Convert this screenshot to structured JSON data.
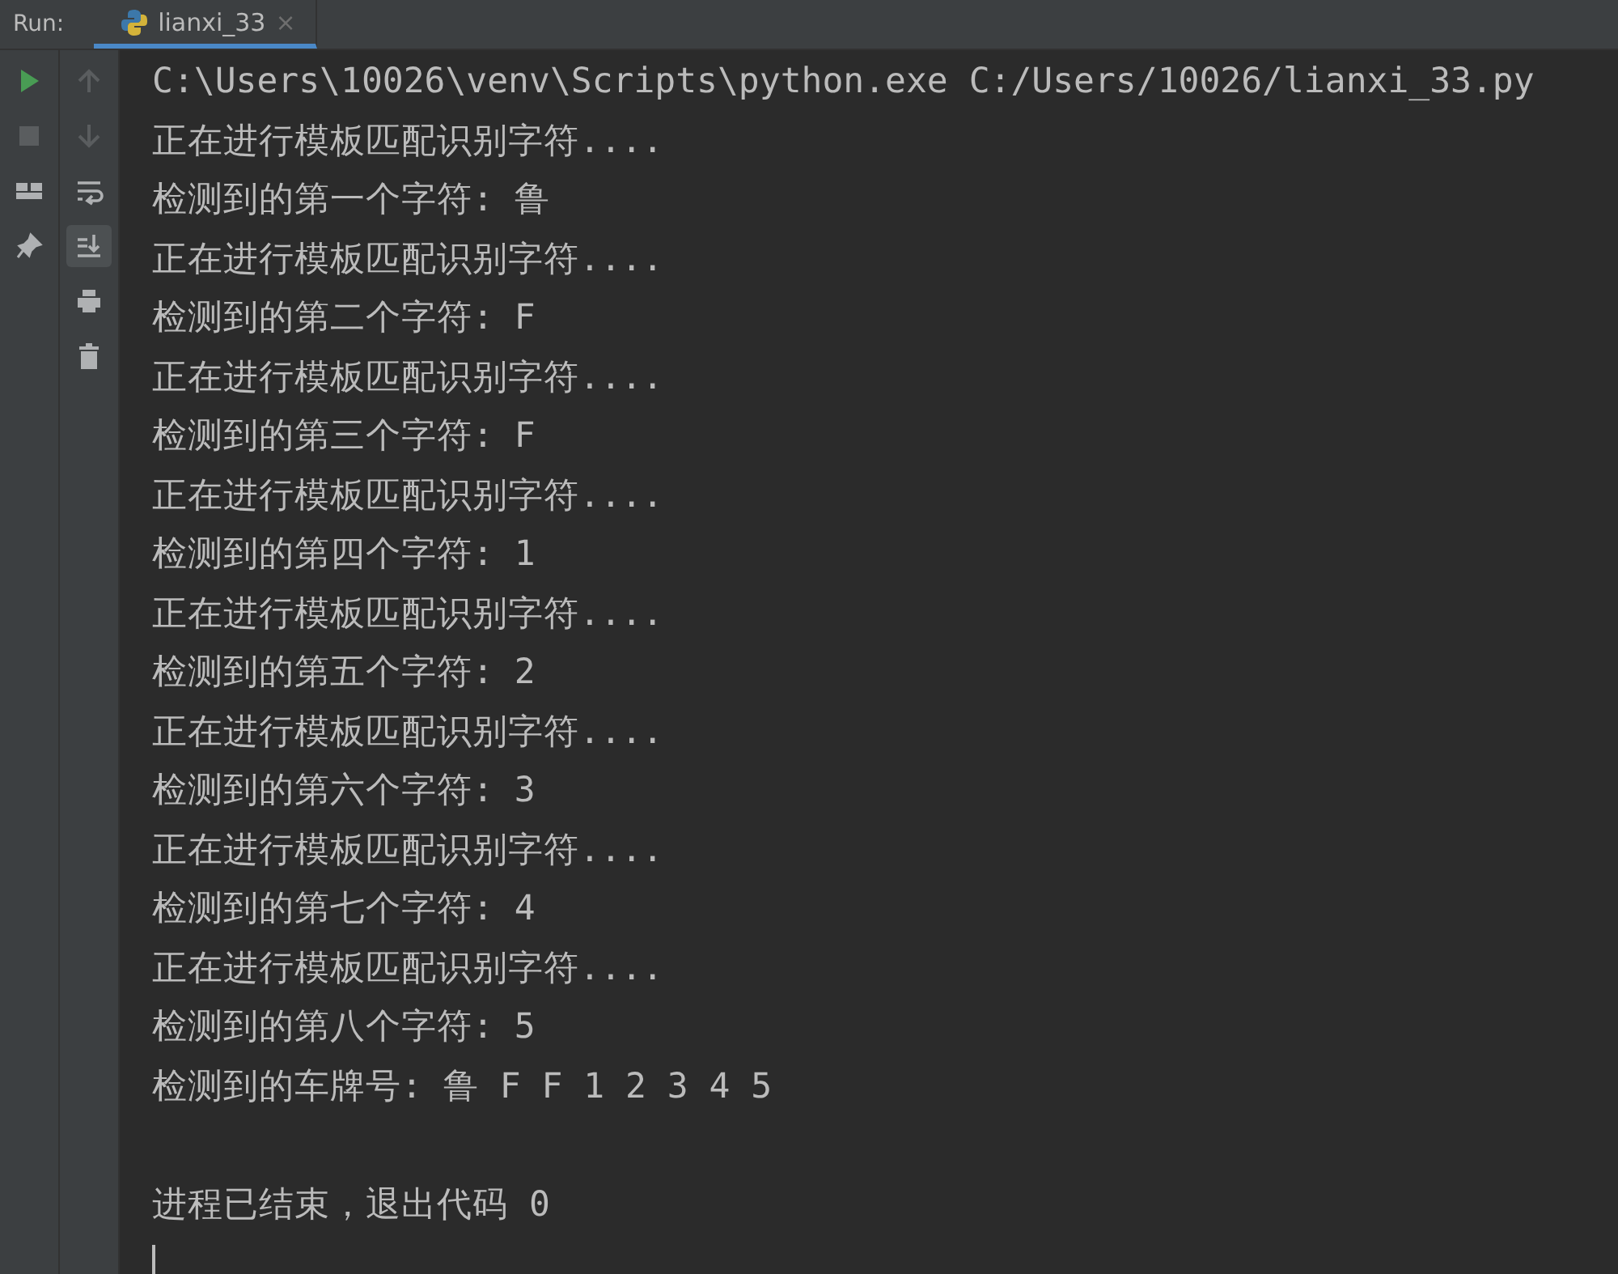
{
  "header": {
    "label": "Run:",
    "tabs": [
      {
        "label": "lianxi_33",
        "close": "×",
        "selected": true
      }
    ]
  },
  "toolbar_left": [
    {
      "kind": "run",
      "disabled": false
    },
    {
      "kind": "stop",
      "disabled": true
    },
    {
      "kind": "layout",
      "disabled": false
    },
    {
      "kind": "pin",
      "disabled": false
    }
  ],
  "toolbar_right": [
    {
      "kind": "up",
      "disabled": true,
      "selected": false
    },
    {
      "kind": "down",
      "disabled": true,
      "selected": false
    },
    {
      "kind": "wrap",
      "disabled": false,
      "selected": false
    },
    {
      "kind": "scroll-end",
      "disabled": false,
      "selected": true
    },
    {
      "kind": "print",
      "disabled": false,
      "selected": false
    },
    {
      "kind": "trash",
      "disabled": false,
      "selected": false
    }
  ],
  "console": {
    "lines": [
      {
        "kind": "command",
        "text": "C:\\Users\\10026\\venv\\Scripts\\python.exe C:/Users/10026/lianxi_33.py"
      },
      {
        "kind": "output",
        "text": "正在进行模板匹配识别字符...."
      },
      {
        "kind": "output",
        "text": "检测到的第一个字符: 鲁"
      },
      {
        "kind": "output",
        "text": "正在进行模板匹配识别字符...."
      },
      {
        "kind": "output",
        "text": "检测到的第二个字符: F"
      },
      {
        "kind": "output",
        "text": "正在进行模板匹配识别字符...."
      },
      {
        "kind": "output",
        "text": "检测到的第三个字符: F"
      },
      {
        "kind": "output",
        "text": "正在进行模板匹配识别字符...."
      },
      {
        "kind": "output",
        "text": "检测到的第四个字符: 1"
      },
      {
        "kind": "output",
        "text": "正在进行模板匹配识别字符...."
      },
      {
        "kind": "output",
        "text": "检测到的第五个字符: 2"
      },
      {
        "kind": "output",
        "text": "正在进行模板匹配识别字符...."
      },
      {
        "kind": "output",
        "text": "检测到的第六个字符: 3"
      },
      {
        "kind": "output",
        "text": "正在进行模板匹配识别字符...."
      },
      {
        "kind": "output",
        "text": "检测到的第七个字符: 4"
      },
      {
        "kind": "output",
        "text": "正在进行模板匹配识别字符...."
      },
      {
        "kind": "output",
        "text": "检测到的第八个字符: 5"
      },
      {
        "kind": "output",
        "text": "检测到的车牌号: 鲁 F F 1 2 3 4 5"
      },
      {
        "kind": "exit",
        "text": "进程已结束，退出代码 0"
      }
    ],
    "caret": true
  }
}
